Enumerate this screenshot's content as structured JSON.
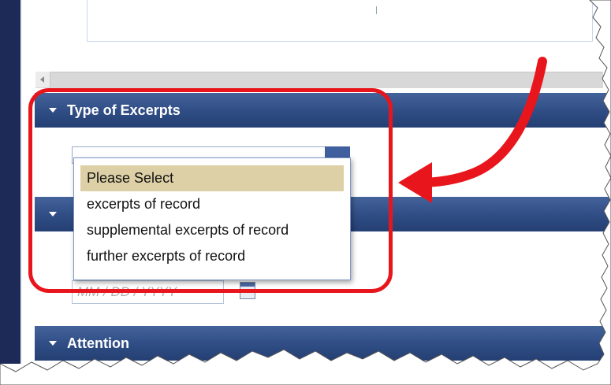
{
  "sections": {
    "type_of_excerpts": {
      "title": "Type of Excerpts"
    },
    "attention": {
      "title": "Attention"
    }
  },
  "type_select": {
    "selected_value": "Please Select",
    "options": [
      "Please Select",
      "excerpts of record",
      "supplemental excerpts of record",
      "further excerpts of record"
    ]
  },
  "date_field": {
    "placeholder": "MM / DD / YYYY"
  },
  "annotation": {
    "highlight_color": "#e8161c",
    "arrow_color": "#e8161c"
  },
  "colors": {
    "header": "#2f4d84",
    "selected_option": "#ddd0a6",
    "sidebar": "#1d2a57"
  }
}
